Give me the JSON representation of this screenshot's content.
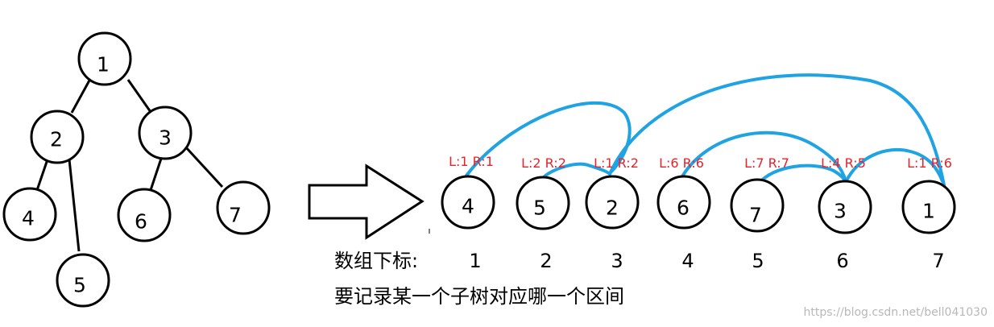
{
  "tree": {
    "nodes": [
      "1",
      "2",
      "3",
      "4",
      "5",
      "6",
      "7"
    ]
  },
  "array": {
    "index_caption": "数组下标:",
    "nodes": [
      {
        "label": "4",
        "range": "L:1 R:1",
        "index": "1"
      },
      {
        "label": "5",
        "range": "L:2 R:2",
        "index": "2"
      },
      {
        "label": "2",
        "range": "L:1 R:2",
        "index": "3"
      },
      {
        "label": "6",
        "range": "L:6 R:6",
        "index": "4"
      },
      {
        "label": "7",
        "range": "L:7 R:7",
        "index": "5"
      },
      {
        "label": "3",
        "range": "L:4 R:5",
        "index": "6"
      },
      {
        "label": "1",
        "range": "L:1 R:6",
        "index": "7"
      }
    ]
  },
  "caption": "要记录某一个子树对应哪一个区间",
  "watermark": "https://blog.csdn.net/bell041030",
  "colors": {
    "arc": "#1fa3e3",
    "range_label": "#e8212b"
  }
}
